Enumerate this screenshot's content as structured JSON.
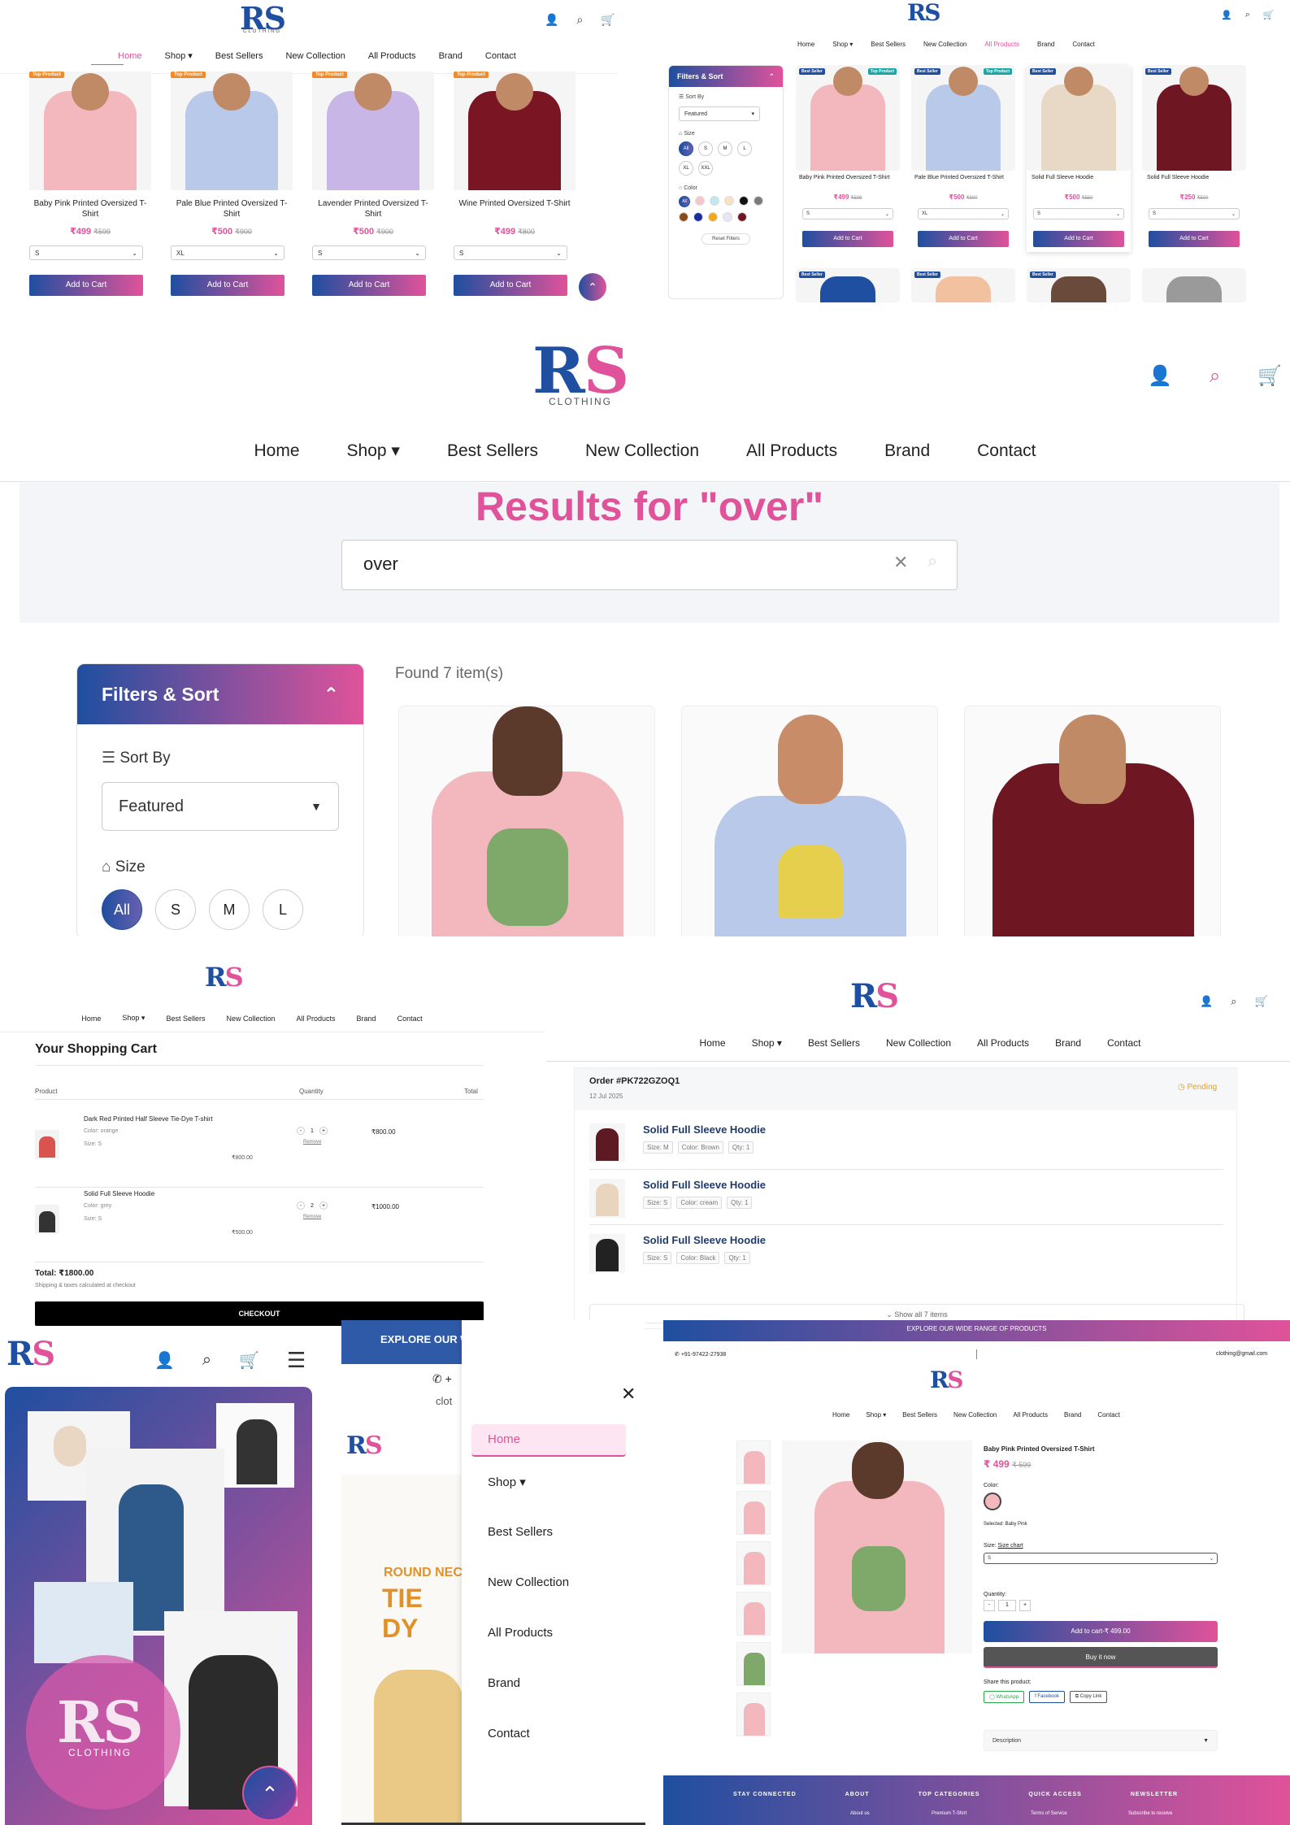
{
  "brand": {
    "logo_main": "RS",
    "logo_sub": "CLOTHING"
  },
  "nav": {
    "home": "Home",
    "shop": "Shop ▾",
    "best": "Best Sellers",
    "newc": "New Collection",
    "all": "All Products",
    "brand": "Brand",
    "contact": "Contact"
  },
  "icons": {
    "user": "user-icon",
    "search": "search-icon",
    "cart": "cart-icon"
  },
  "colors": {
    "accent_pink": "#e0529a",
    "accent_blue": "#1f4fa0"
  },
  "home_panel": {
    "badge": "Top Product",
    "products": [
      {
        "name": "Baby Pink Printed Oversized T-Shirt",
        "price": "₹499",
        "old": "₹599",
        "size": "S",
        "color": "#f2b8bd"
      },
      {
        "name": "Pale Blue Printed Oversized T-Shirt",
        "price": "₹500",
        "old": "₹900",
        "size": "XL",
        "color": "#b8c9ea"
      },
      {
        "name": "Lavender Printed Oversized T-Shirt",
        "price": "₹500",
        "old": "₹900",
        "size": "S",
        "color": "#c8b6e6"
      },
      {
        "name": "Wine Printed Oversized T-Shirt",
        "price": "₹499",
        "old": "₹800",
        "size": "S",
        "color": "#7a1524"
      }
    ],
    "add_to_cart": "Add to Cart"
  },
  "all_products_panel": {
    "filters_title": "Filters & Sort",
    "sort_by": "Sort By",
    "sort_value": "Featured",
    "size": "Size",
    "sizes": [
      "All",
      "S",
      "M",
      "L",
      "XL",
      "XXL"
    ],
    "color": "Color",
    "color_all": "All",
    "reset": "Reset Filters",
    "badges": {
      "best": "Best Seller",
      "top": "Top Product"
    },
    "products": [
      {
        "name": "Baby Pink Printed Oversized T-Shirt",
        "price": "₹499",
        "old": "₹599",
        "size": "S",
        "color": "#f2b8bd"
      },
      {
        "name": "Pale Blue Printed Oversized T-Shirt",
        "price": "₹500",
        "old": "₹900",
        "size": "XL",
        "color": "#b8c9ea"
      },
      {
        "name": "Solid Full Sleeve Hoodie",
        "price": "₹500",
        "old": "₹550",
        "size": "S",
        "color": "#e8d8c6"
      },
      {
        "name": "Solid Full Sleeve Hoodie",
        "price": "₹250",
        "old": "₹500",
        "size": "S",
        "color": "#6e1622"
      }
    ],
    "add_to_cart": "Add to Cart"
  },
  "search_panel": {
    "heading": "Results for \"over\"",
    "query": "over",
    "found": "Found 7 item(s)",
    "filters_title": "Filters & Sort",
    "sort_by": "Sort By",
    "sort_value": "Featured",
    "size": "Size",
    "sizes": [
      "All",
      "S",
      "M",
      "L"
    ]
  },
  "cart_panel": {
    "title": "Your Shopping Cart",
    "col_product": "Product",
    "col_qty": "Quantity",
    "col_total": "Total",
    "items": [
      {
        "name": "Dark Red Printed Half Sleeve Tie-Dye T-shirt",
        "color": "Color: orange",
        "size": "Size: S",
        "unit": "₹800.00",
        "qty": "1",
        "total": "₹800.00",
        "remove": "Remove"
      },
      {
        "name": "Solid Full Sleeve Hoodie",
        "color": "Color: grey",
        "size": "Size: S",
        "unit": "₹500.00",
        "qty": "2",
        "total": "₹1000.00",
        "remove": "Remove"
      }
    ],
    "total": "Total: ₹1800.00",
    "note": "Shipping & taxes calculated at checkout",
    "checkout": "CHECKOUT"
  },
  "order_panel": {
    "order_id": "Order #PK722GZOQ1",
    "date": "12 Jul 2025",
    "status": "Pending",
    "items": [
      {
        "name": "Solid Full Sleeve Hoodie",
        "size": "Size: M",
        "color": "Color: Brown",
        "qty": "Qty: 1"
      },
      {
        "name": "Solid Full Sleeve Hoodie",
        "size": "Size: S",
        "color": "Color: cream",
        "qty": "Qty: 1"
      },
      {
        "name": "Solid Full Sleeve Hoodie",
        "size": "Size: S",
        "color": "Color: Black",
        "qty": "Qty: 1"
      }
    ],
    "show_all": "⌄ Show all 7 items"
  },
  "mobile_panel": {
    "menu_icon": "hamburger-icon",
    "logo_big": "RS",
    "logo_big_sub": "CLOTHING"
  },
  "drawer_panel": {
    "banner": "EXPLORE OUR W",
    "contact_short": "clot",
    "promo_small": "ROUND NEC",
    "promo_big": "TIE DY",
    "items": [
      "Home",
      "Shop ▾",
      "Best Sellers",
      "New Collection",
      "All Products",
      "Brand",
      "Contact"
    ]
  },
  "pdp_panel": {
    "banner": "EXPLORE OUR WIDE RANGE OF PRODUCTS",
    "phone": "+91-97422-27938",
    "email": "clothing@gmail.com",
    "title": "Baby Pink Printed Oversized T-Shirt",
    "price": "₹ 499",
    "old": "₹ 599",
    "color_label": "Color:",
    "selected": "Selected: Baby Pink",
    "size_label": "Size:",
    "size_chart": "Size chart",
    "size_value": "S",
    "qty_label": "Quantity:",
    "qty": "1",
    "add": "Add to cart-₹ 499.00",
    "buy": "Buy it now",
    "share": "Share this product:",
    "whatsapp": "WhatsApp",
    "facebook": "Facebook",
    "copy": "Copy Link",
    "description": "Description",
    "footer": [
      "STAY CONNECTED",
      "ABOUT",
      "TOP CATEGORIES",
      "QUICK ACCESS",
      "NEWSLETTER"
    ],
    "footer_sub": [
      "About us",
      "Premium T-Shirt",
      "Terms of Service",
      "Subscribe to receive"
    ]
  }
}
